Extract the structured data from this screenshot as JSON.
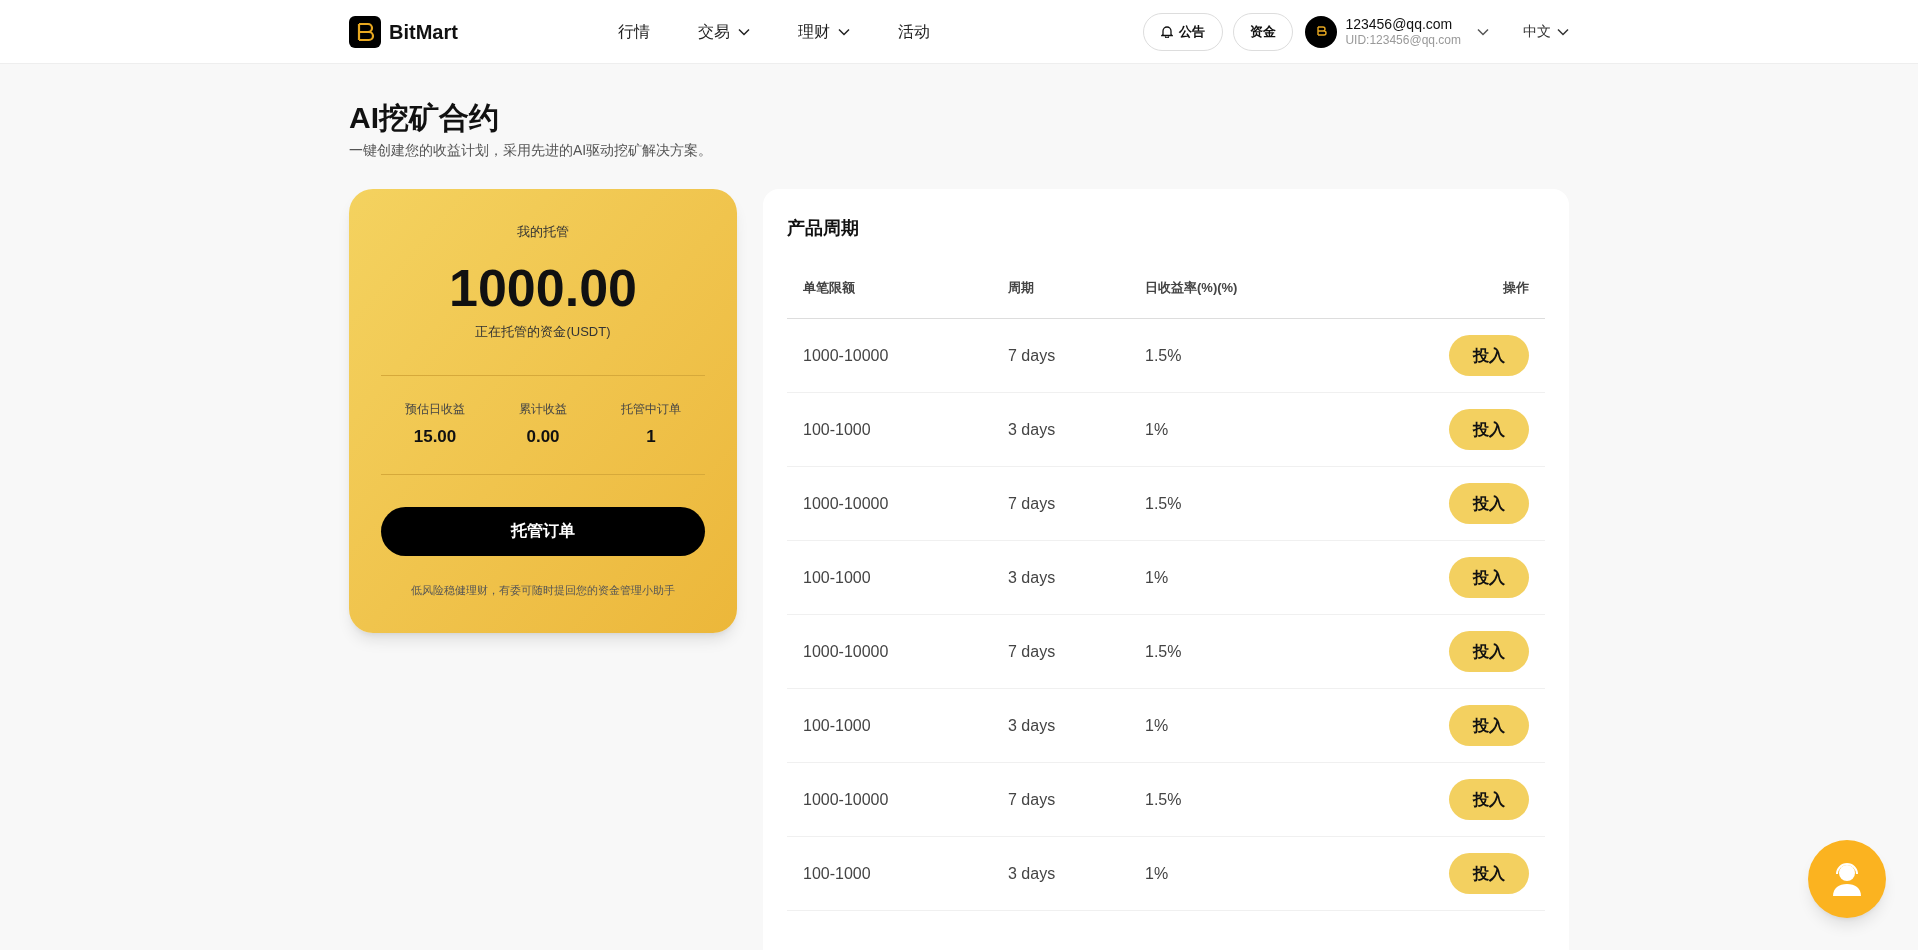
{
  "header": {
    "brand": "BitMart",
    "nav": [
      {
        "label": "行情",
        "dropdown": false
      },
      {
        "label": "交易",
        "dropdown": true
      },
      {
        "label": "理财",
        "dropdown": true
      },
      {
        "label": "活动",
        "dropdown": false
      }
    ],
    "announce_button": "公告",
    "funds_button": "资金",
    "user": {
      "email": "123456@qq.com",
      "uid": "UID:123456@qq.com"
    },
    "language": "中文"
  },
  "page": {
    "title": "AI挖矿合约",
    "subtitle": "一键创建您的收益计划，采用先进的AI驱动挖矿解决方案。"
  },
  "custody_card": {
    "title": "我的托管",
    "amount": "1000.00",
    "amount_label": "正在托管的资金(USDT)",
    "stats": [
      {
        "label": "预估日收益",
        "value": "15.00"
      },
      {
        "label": "累计收益",
        "value": "0.00"
      },
      {
        "label": "托管中订单",
        "value": "1"
      }
    ],
    "button": "托管订单",
    "footnote": "低风险稳健理财，有委可随时提回您的资金管理小助手"
  },
  "product_table": {
    "title": "产品周期",
    "columns": [
      "单笔限额",
      "周期",
      "日收益率(%)(%)",
      "操作"
    ],
    "rows": [
      {
        "limit": "1000-10000",
        "period": "7 days",
        "rate": "1.5%",
        "action": "投入"
      },
      {
        "limit": "100-1000",
        "period": "3 days",
        "rate": "1%",
        "action": "投入"
      },
      {
        "limit": "1000-10000",
        "period": "7 days",
        "rate": "1.5%",
        "action": "投入"
      },
      {
        "limit": "100-1000",
        "period": "3 days",
        "rate": "1%",
        "action": "投入"
      },
      {
        "limit": "1000-10000",
        "period": "7 days",
        "rate": "1.5%",
        "action": "投入"
      },
      {
        "limit": "100-1000",
        "period": "3 days",
        "rate": "1%",
        "action": "投入"
      },
      {
        "limit": "1000-10000",
        "period": "7 days",
        "rate": "1.5%",
        "action": "投入"
      },
      {
        "limit": "100-1000",
        "period": "3 days",
        "rate": "1%",
        "action": "投入"
      }
    ]
  }
}
